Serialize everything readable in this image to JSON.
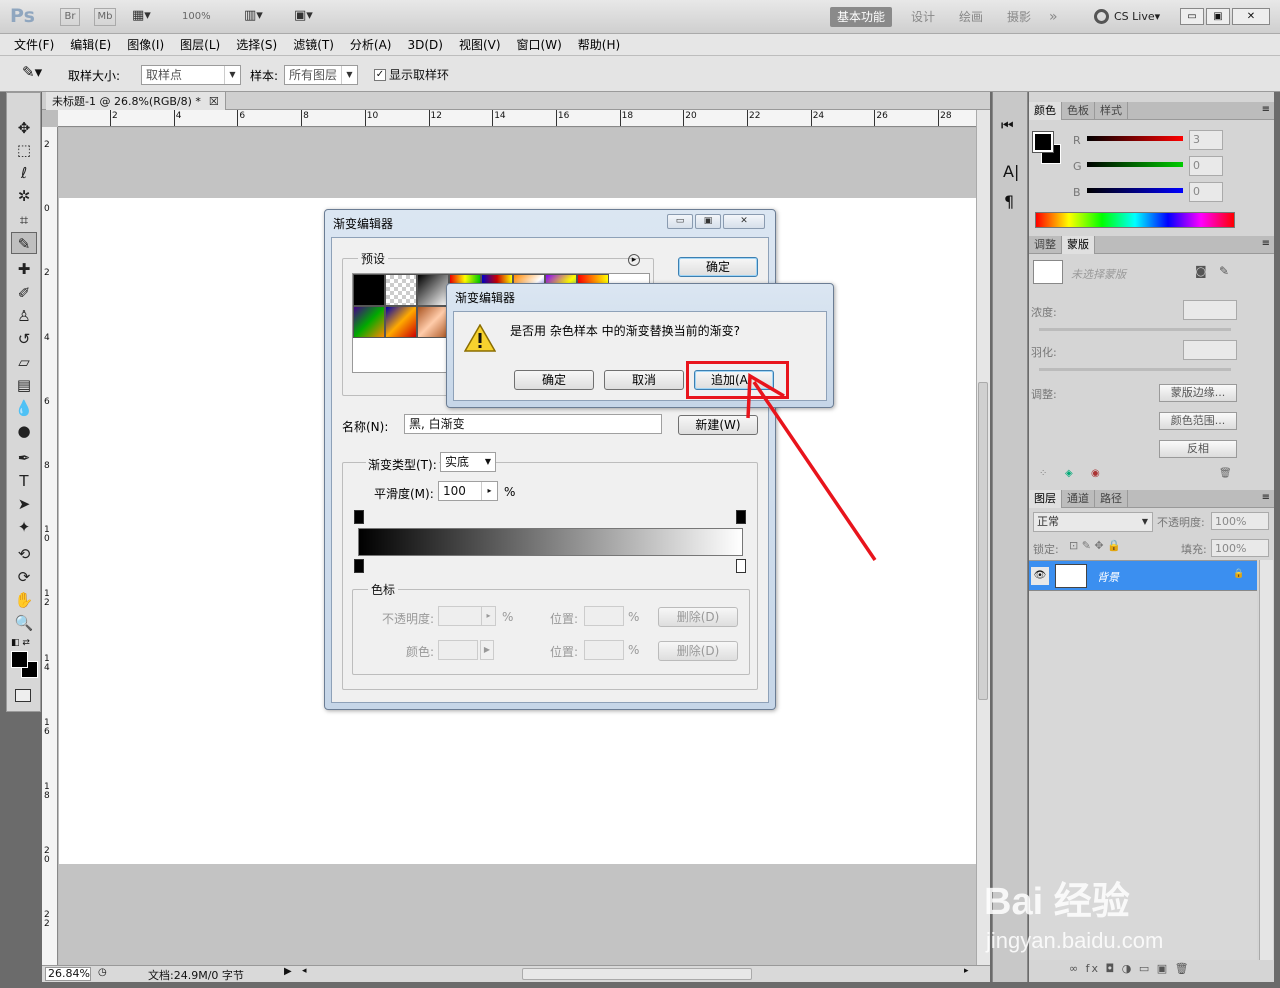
{
  "app": {
    "logo": "Ps",
    "bridge_label": "Br",
    "minibridge_label": "Mb",
    "zoom_combo": "100%",
    "workspaces": [
      "基本功能",
      "设计",
      "绘画",
      "摄影"
    ],
    "more_label": "»",
    "cslive": "CS Live",
    "window_controls": [
      "▭",
      "▣",
      "✕"
    ]
  },
  "menu": [
    "文件(F)",
    "编辑(E)",
    "图像(I)",
    "图层(L)",
    "选择(S)",
    "滤镜(T)",
    "分析(A)",
    "3D(D)",
    "视图(V)",
    "窗口(W)",
    "帮助(H)"
  ],
  "options": {
    "sample_size_label": "取样大小:",
    "sample_size_value": "取样点",
    "sample_label": "样本:",
    "sample_value": "所有图层",
    "show_ring_label": "显示取样环",
    "show_ring_checked": true
  },
  "document": {
    "tab_title": "未标题-1 @ 26.8%(RGB/8) *",
    "close_glyph": "☒",
    "h_ruler_labels": [
      "2",
      "4",
      "6",
      "8",
      "10",
      "12",
      "14",
      "16",
      "18",
      "20",
      "22",
      "24",
      "26",
      "28"
    ],
    "v_ruler_labels": [
      "2",
      "0",
      "2",
      "4",
      "6",
      "8",
      "1\n0",
      "1\n2",
      "1\n4",
      "1\n6",
      "1\n8",
      "2\n0",
      "2\n2"
    ],
    "zoom": "26.84%",
    "doc_info": "文档:24.9M/0 字节"
  },
  "gradient_editor": {
    "title": "渐变编辑器",
    "presets_label": "预设",
    "ok": "确定",
    "cancel": "取消",
    "name_label": "名称(N):",
    "name_value": "黑, 白渐变",
    "new_button": "新建(W)",
    "type_label": "渐变类型(T):",
    "type_value": "实底",
    "smooth_label": "平滑度(M):",
    "smooth_value": "100",
    "percent": "%",
    "stops_label": "色标",
    "opacity_label": "不透明度:",
    "location_label": "位置:",
    "color_label": "颜色:",
    "delete_button": "删除(D)"
  },
  "confirm_dialog": {
    "title": "渐变编辑器",
    "message": "是否用 杂色样本 中的渐变替换当前的渐变?",
    "ok": "确定",
    "cancel": "取消",
    "append": "追加(A)"
  },
  "right_panels": {
    "color_tabs": [
      "颜色",
      "色板",
      "样式"
    ],
    "r_label": "R",
    "g_label": "G",
    "b_label": "B",
    "r_value": "3",
    "g_value": "0",
    "b_value": "0",
    "adjust_tabs": [
      "调整",
      "蒙版"
    ],
    "no_mask": "未选择蒙版",
    "density_label": "浓度:",
    "feather_label": "羽化:",
    "refine_label": "调整:",
    "mask_edge": "蒙版边缘...",
    "color_range": "颜色范围...",
    "invert": "反相",
    "layer_tabs": [
      "图层",
      "通道",
      "路径"
    ],
    "blend_mode": "正常",
    "opacity_label": "不透明度:",
    "opacity_value": "100%",
    "lock_label": "锁定:",
    "fill_label": "填充:",
    "fill_value": "100%",
    "layer_name": "背景",
    "footer_icons": "∞  fx  ◘  ◑  ▭  ▣  🗑"
  },
  "watermark": {
    "brand": "Bai 经验",
    "url": "jingyan.baidu.com"
  },
  "colors": {
    "accent_blue": "#3b8ff0",
    "highlight_red": "#e8141c",
    "layer_selected": "#3b8ff0"
  }
}
